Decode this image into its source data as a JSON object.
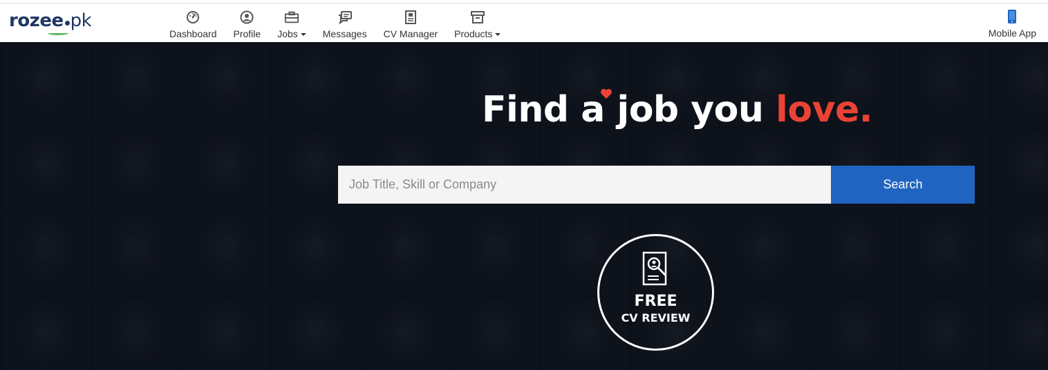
{
  "logo": {
    "brand": "rozee",
    "suffix": "pk"
  },
  "nav": {
    "items": [
      {
        "label": "Dashboard",
        "icon": "dashboard-gauge-icon"
      },
      {
        "label": "Profile",
        "icon": "user-circle-icon"
      },
      {
        "label": "Jobs",
        "icon": "briefcase-icon",
        "dropdown": true
      },
      {
        "label": "Messages",
        "icon": "chat-bubbles-icon"
      },
      {
        "label": "CV Manager",
        "icon": "document-icon"
      },
      {
        "label": "Products",
        "icon": "archive-box-icon",
        "dropdown": true
      }
    ],
    "mobile_app": {
      "label": "Mobile App",
      "icon": "smartphone-icon"
    }
  },
  "hero": {
    "headline_part1": "Find a job you ",
    "headline_highlight": "love.",
    "search": {
      "placeholder": "Job Title, Skill or Company",
      "value": "",
      "button_label": "Search"
    },
    "cv_review": {
      "line1": "FREE",
      "line2": "CV REVIEW",
      "icon": "cv-search-icon"
    }
  },
  "colors": {
    "brand_navy": "#1f3864",
    "accent_red": "#ea4335",
    "search_blue": "#1f64c0",
    "hero_bg": "#0e141d"
  }
}
